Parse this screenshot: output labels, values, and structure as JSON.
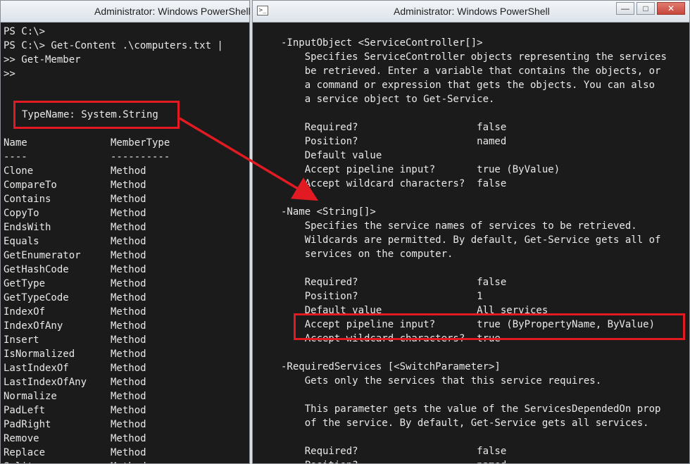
{
  "left_window": {
    "title": "Administrator: Windows PowerShell",
    "prompt_lines": [
      "PS C:\\>",
      "PS C:\\> Get-Content .\\computers.txt |",
      ">> Get-Member",
      ">>"
    ],
    "type_name": "TypeName: System.String",
    "headers": {
      "name": "Name",
      "type": "MemberType"
    },
    "underlines": {
      "name": "----",
      "type": "----------"
    },
    "members": [
      {
        "name": "Clone",
        "type": "Method"
      },
      {
        "name": "CompareTo",
        "type": "Method"
      },
      {
        "name": "Contains",
        "type": "Method"
      },
      {
        "name": "CopyTo",
        "type": "Method"
      },
      {
        "name": "EndsWith",
        "type": "Method"
      },
      {
        "name": "Equals",
        "type": "Method"
      },
      {
        "name": "GetEnumerator",
        "type": "Method"
      },
      {
        "name": "GetHashCode",
        "type": "Method"
      },
      {
        "name": "GetType",
        "type": "Method"
      },
      {
        "name": "GetTypeCode",
        "type": "Method"
      },
      {
        "name": "IndexOf",
        "type": "Method"
      },
      {
        "name": "IndexOfAny",
        "type": "Method"
      },
      {
        "name": "Insert",
        "type": "Method"
      },
      {
        "name": "IsNormalized",
        "type": "Method"
      },
      {
        "name": "LastIndexOf",
        "type": "Method"
      },
      {
        "name": "LastIndexOfAny",
        "type": "Method"
      },
      {
        "name": "Normalize",
        "type": "Method"
      },
      {
        "name": "PadLeft",
        "type": "Method"
      },
      {
        "name": "PadRight",
        "type": "Method"
      },
      {
        "name": "Remove",
        "type": "Method"
      },
      {
        "name": "Replace",
        "type": "Method"
      },
      {
        "name": "Split",
        "type": "Method"
      }
    ]
  },
  "right_window": {
    "title": "Administrator: Windows PowerShell",
    "controls": {
      "minimize": "—",
      "maximize": "□",
      "close": "✕"
    },
    "lines": [
      "-InputObject <ServiceController[]>",
      "    Specifies ServiceController objects representing the services",
      "    be retrieved. Enter a variable that contains the objects, or",
      "    a command or expression that gets the objects. You can also",
      "    a service object to Get-Service.",
      "",
      "    Required?                    false",
      "    Position?                    named",
      "    Default value",
      "    Accept pipeline input?       true (ByValue)",
      "    Accept wildcard characters?  false",
      "",
      "-Name <String[]>",
      "    Specifies the service names of services to be retrieved.",
      "    Wildcards are permitted. By default, Get-Service gets all of",
      "    services on the computer.",
      "",
      "    Required?                    false",
      "    Position?                    1",
      "    Default value                All services",
      "    Accept pipeline input?       true (ByPropertyName, ByValue)",
      "    Accept wildcard characters?  true",
      "",
      "-RequiredServices [<SwitchParameter>]",
      "    Gets only the services that this service requires.",
      "",
      "    This parameter gets the value of the ServicesDependedOn prop",
      "    of the service. By default, Get-Service gets all services.",
      "",
      "    Required?                    false",
      "    Position?                    named"
    ]
  },
  "colors": {
    "console_bg": "#1b1b1b",
    "console_text": "#e9e9e9",
    "highlight": "#e21b23"
  }
}
